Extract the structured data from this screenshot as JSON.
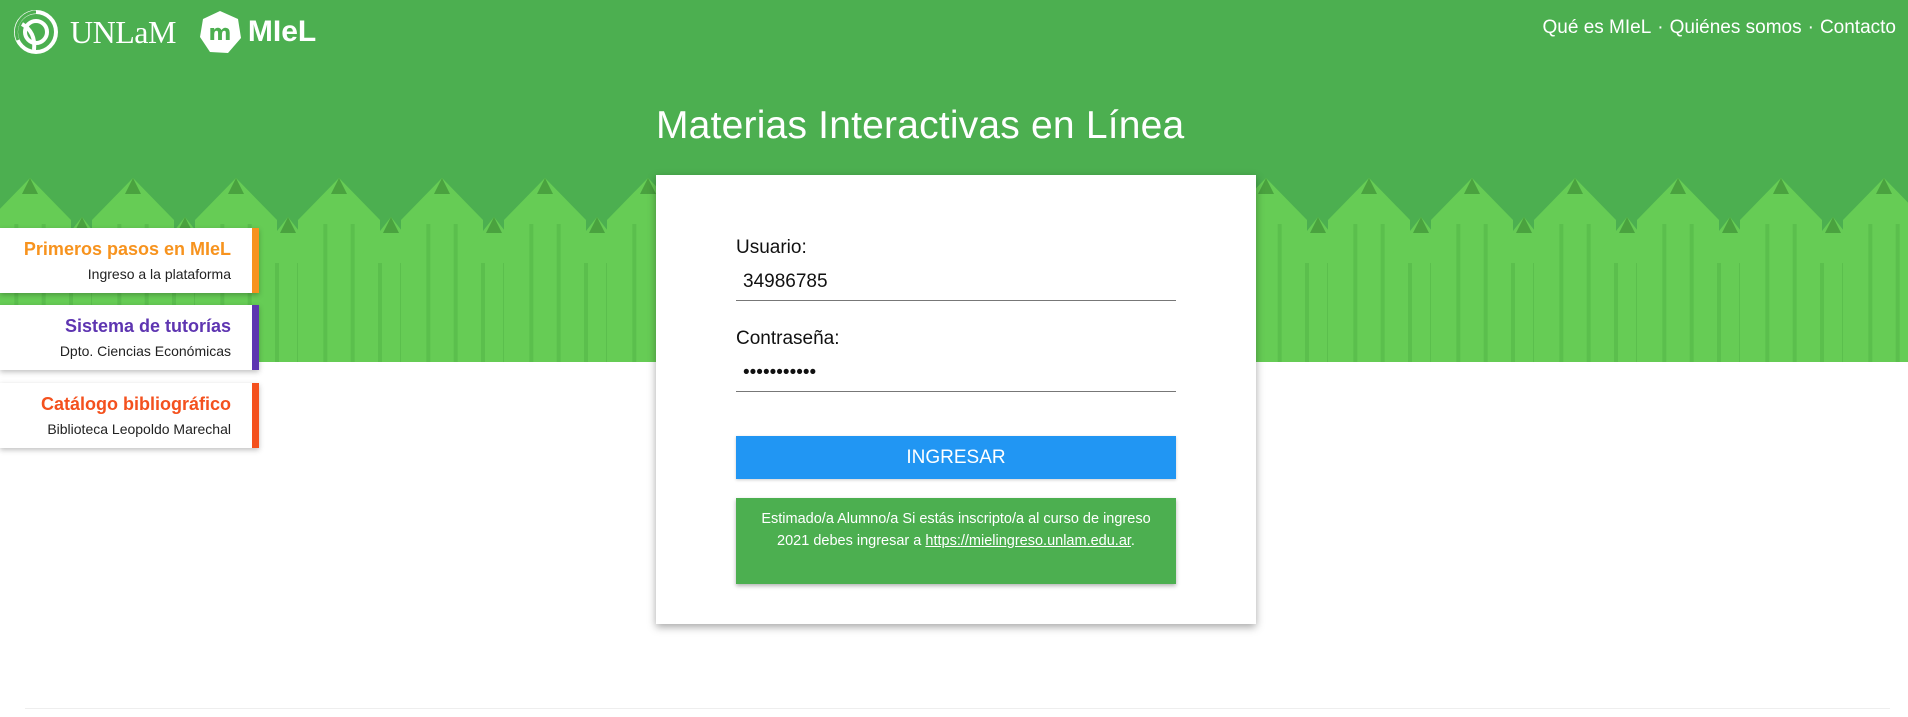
{
  "brand": {
    "unlam_text": "UNLaM",
    "miel_text": "MIeL",
    "unlam_icon": "unlam-logo-icon",
    "miel_icon": "miel-m-logo-icon"
  },
  "nav": {
    "items": [
      "Qué es MIeL",
      "Quiénes somos",
      "Contacto"
    ],
    "separator": "·"
  },
  "hero": {
    "title": "Materias Interactivas en Línea"
  },
  "side_cards": [
    {
      "title": "Primeros pasos en MIeL",
      "subtitle": "Ingreso a la plataforma",
      "color": "#f7931e"
    },
    {
      "title": "Sistema de tutorías",
      "subtitle": "Dpto. Ciencias Económicas",
      "color": "#5e35b1"
    },
    {
      "title": "Catálogo bibliográfico",
      "subtitle": "Biblioteca Leopoldo Marechal",
      "color": "#f4511e"
    }
  ],
  "login": {
    "user_label": "Usuario:",
    "user_value": "34986785",
    "pass_label": "Contraseña:",
    "pass_value": "•••••••••••",
    "submit_label": "INGRESAR",
    "notice_text": "Estimado/a Alumno/a Si estás inscripto/a al curso de ingreso 2021 debes ingresar a",
    "notice_link": "https://mielingreso.unlam.edu.ar",
    "notice_end": "."
  },
  "colors": {
    "header_green": "#4caf50",
    "pencil_light": "#66cc55",
    "button_blue": "#2196f3"
  }
}
